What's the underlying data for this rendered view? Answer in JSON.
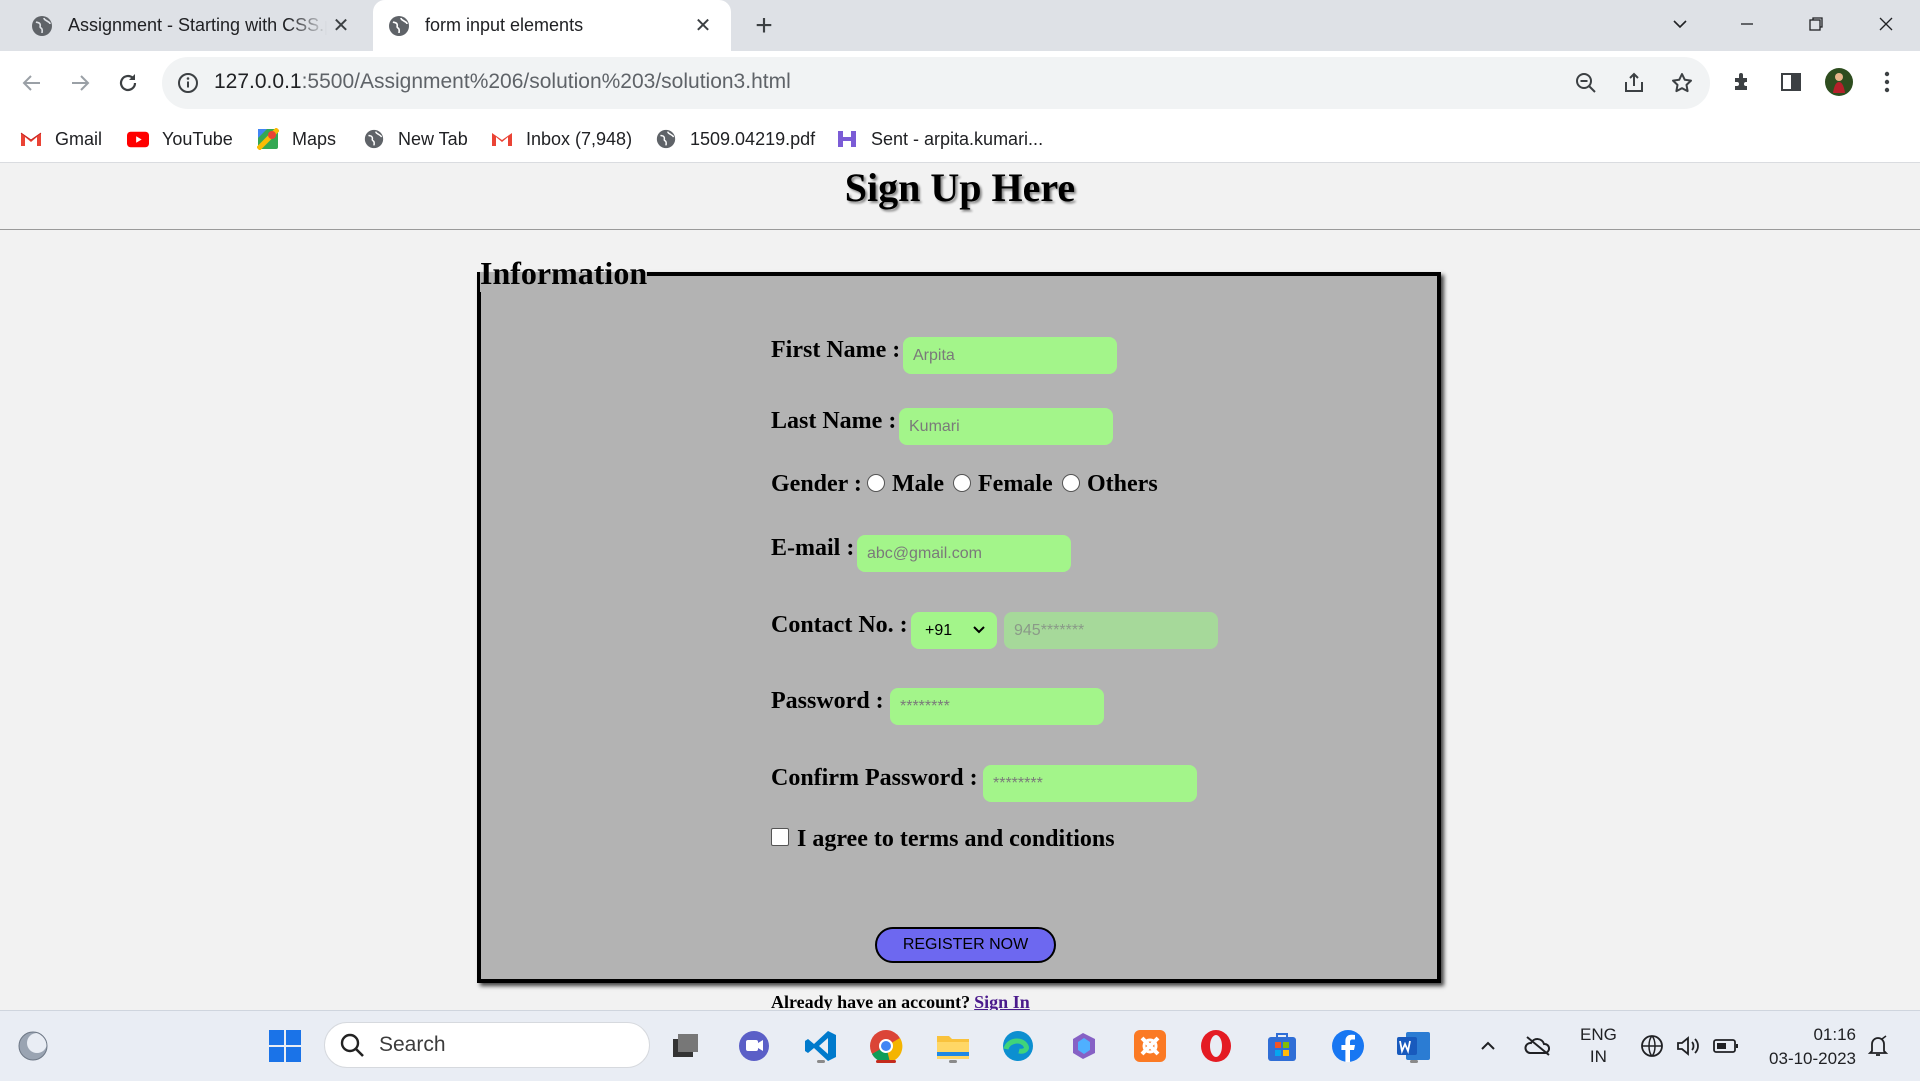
{
  "browser": {
    "tabs": [
      {
        "title": "Assignment - Starting with CSS.p",
        "active": false
      },
      {
        "title": "form input elements",
        "active": true
      }
    ],
    "url_host": "127.0.0.1",
    "url_path": ":5500/Assignment%206/solution%203/solution3.html",
    "bookmarks": [
      {
        "label": "Gmail",
        "icon": "gmail-icon"
      },
      {
        "label": "YouTube",
        "icon": "youtube-icon"
      },
      {
        "label": "Maps",
        "icon": "maps-icon"
      },
      {
        "label": "New Tab",
        "icon": "globe-icon"
      },
      {
        "label": "Inbox (7,948)",
        "icon": "gmail-icon"
      },
      {
        "label": "1509.04219.pdf",
        "icon": "globe-icon"
      },
      {
        "label": "Sent - arpita.kumari...",
        "icon": "mail-app-icon"
      }
    ]
  },
  "page": {
    "heading": "Sign Up Here",
    "legend": "Information",
    "first_name_label": "First Name :",
    "first_name_placeholder": "Arpita",
    "last_name_label": "Last Name :",
    "last_name_placeholder": "Kumari",
    "gender_label": "Gender :",
    "gender_options": [
      "Male",
      "Female",
      "Others"
    ],
    "email_label": "E-mail :",
    "email_placeholder": "abc@gmail.com",
    "contact_label": "Contact No. :",
    "country_code": "+91",
    "phone_placeholder": "945*******",
    "password_label": "Password :",
    "password_placeholder": "********",
    "confirm_label": "Confirm Password :",
    "confirm_placeholder": "********",
    "terms_label": "I agree to terms and conditions",
    "register_button": "REGISTER NOW",
    "already_text": "Already have an account?",
    "signin_link": "Sign In"
  },
  "taskbar": {
    "search_label": "Search",
    "language_top": "ENG",
    "language_bottom": "IN",
    "time": "01:16",
    "date": "03-10-2023"
  },
  "colors": {
    "input_bg": "#a3f58a",
    "fieldset_bg": "#b3b3b3",
    "register_bg": "#6d68f0",
    "link": "#4b1a8c"
  }
}
